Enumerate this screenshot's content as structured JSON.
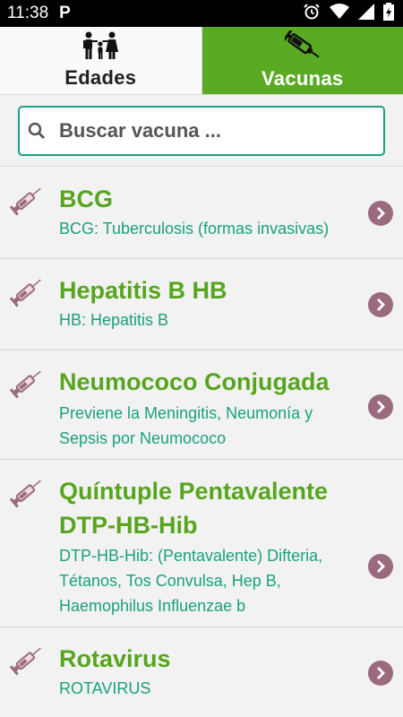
{
  "status_bar": {
    "time": "11:38",
    "app_badge": "P",
    "icons": [
      "alarm-icon",
      "wifi-icon",
      "signal-icon",
      "battery-icon"
    ]
  },
  "tabs": [
    {
      "label": "Edades",
      "icon": "family-icon",
      "selected": false
    },
    {
      "label": "Vacunas",
      "icon": "syringe-icon",
      "selected": true
    }
  ],
  "search": {
    "placeholder": "Buscar vacuna ...",
    "value": ""
  },
  "colors": {
    "accent_green": "#5aaa23",
    "title_green": "#57a51e",
    "subtitle_teal": "#19a17e",
    "chevron": "#9a6b7e",
    "search_border": "#1ba187"
  },
  "vaccines": [
    {
      "title": "BCG",
      "subtitle": "BCG: Tuberculosis (formas invasivas)"
    },
    {
      "title": "Hepatitis B HB",
      "subtitle": "HB: Hepatitis B"
    },
    {
      "title": "Neumococo Conjugada",
      "subtitle_lines": [
        "Previene la Meningitis, Neumonía y",
        "Sepsis por Neumococo"
      ]
    },
    {
      "title_lines": [
        "Quíntuple Pentavalente",
        "DTP-HB-Hib"
      ],
      "subtitle_lines": [
        "DTP-HB-Hib: (Pentavalente) Difteria,",
        "Tétanos, Tos Convulsa, Hep B,",
        "Haemophilus Influenzae b"
      ]
    },
    {
      "title": "Rotavirus",
      "subtitle": "ROTAVIRUS"
    }
  ]
}
